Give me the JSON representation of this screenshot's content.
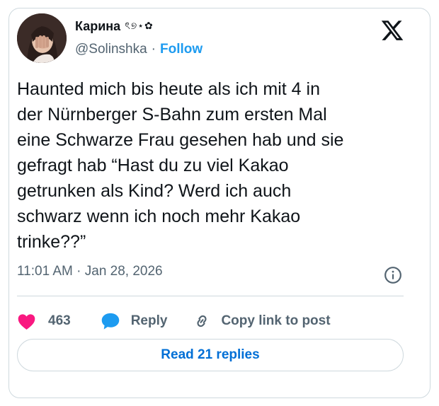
{
  "author": {
    "name": "Карина",
    "name_emoji": "ৎ୭⋆✿",
    "handle": "@Solinshka",
    "separator": "·",
    "follow_label": "Follow"
  },
  "icons": {
    "logo": "x-logo-icon",
    "info": "info-icon",
    "like": "heart-icon",
    "reply": "speech-bubble-icon",
    "copy": "link-icon"
  },
  "tweet": {
    "text": "Haunted mich bis heute als ich mit 4 in\nder Nürnberger S-Bahn zum ersten Mal\neine Schwarze Frau gesehen hab und sie\ngefragt hab “Hast du zu viel Kakao\ngetrunken als Kind? Werd ich auch\nschwarz wenn ich noch mehr Kakao\ntrinke??”",
    "timestamp": "11:01 AM · Jan 28, 2026"
  },
  "actions": {
    "like_count": "463",
    "reply_label": "Reply",
    "copy_label": "Copy link to post"
  },
  "read_replies_label": "Read 21 replies",
  "colors": {
    "accent": "#1d9bf0",
    "like": "#f91880",
    "muted": "#536471",
    "border": "#cfd9de"
  }
}
